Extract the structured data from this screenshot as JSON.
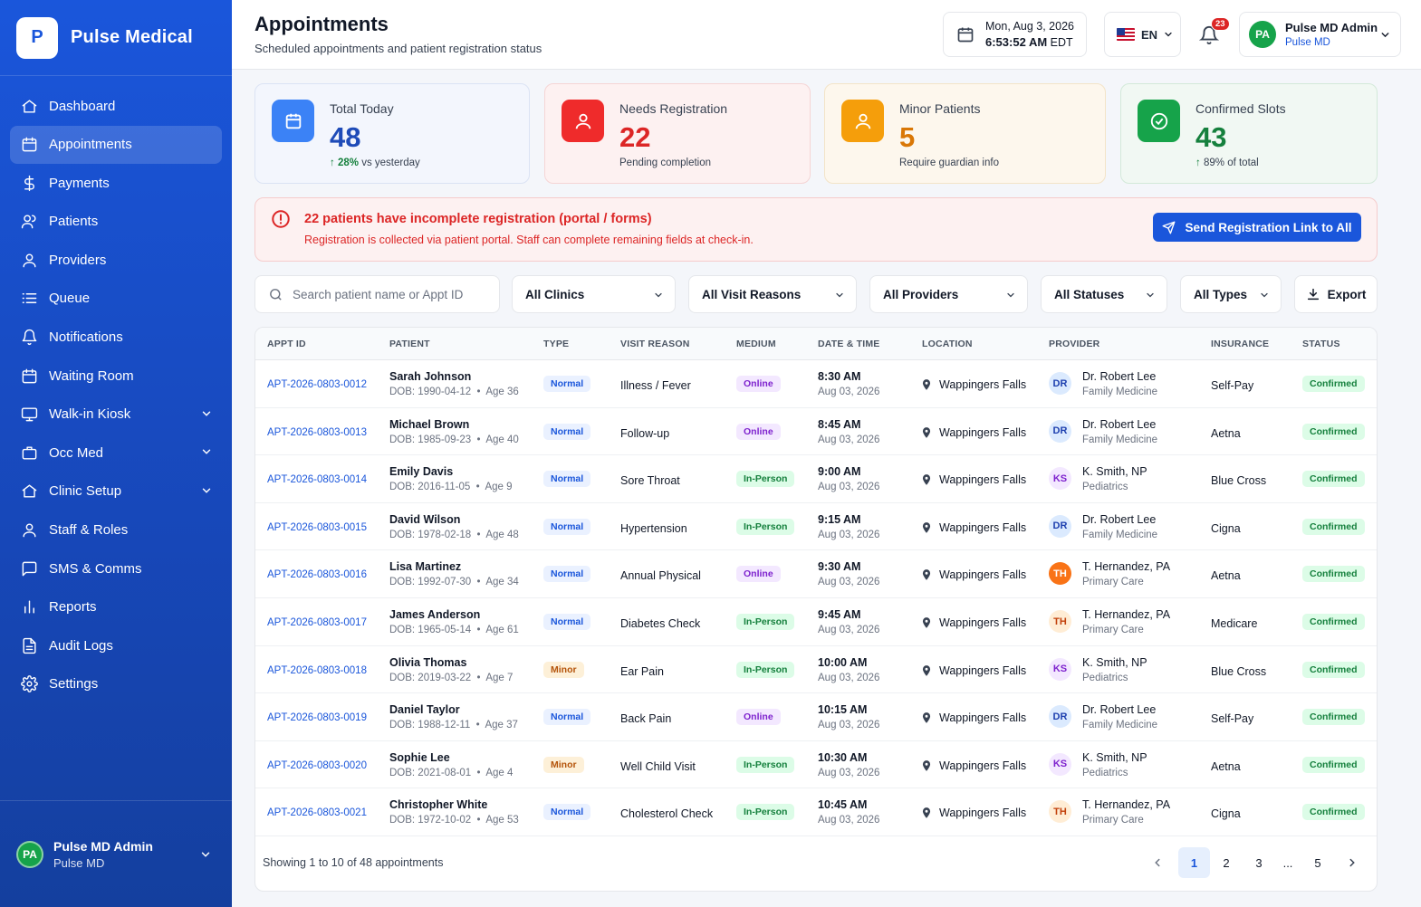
{
  "brand": {
    "logo_letter": "P",
    "name": "Pulse Medical"
  },
  "sidebar": {
    "items": [
      {
        "label": "Dashboard",
        "icon": "home-icon"
      },
      {
        "label": "Appointments",
        "icon": "calendar-icon",
        "active": true
      },
      {
        "label": "Payments",
        "icon": "dollar-icon"
      },
      {
        "label": "Patients",
        "icon": "users-icon"
      },
      {
        "label": "Providers",
        "icon": "user-icon"
      },
      {
        "label": "Queue",
        "icon": "list-icon"
      },
      {
        "label": "Notifications",
        "icon": "bell-icon"
      },
      {
        "label": "Waiting Room",
        "icon": "calendar-icon"
      },
      {
        "label": "Walk-in Kiosk",
        "icon": "monitor-icon",
        "expandable": true
      },
      {
        "label": "Occ Med",
        "icon": "briefcase-icon",
        "expandable": true
      },
      {
        "label": "Clinic Setup",
        "icon": "home-icon",
        "expandable": true
      },
      {
        "label": "Staff & Roles",
        "icon": "user-icon"
      },
      {
        "label": "SMS & Comms",
        "icon": "chat-icon"
      },
      {
        "label": "Reports",
        "icon": "bar-chart-icon"
      },
      {
        "label": "Audit Logs",
        "icon": "file-icon"
      },
      {
        "label": "Settings",
        "icon": "gear-icon"
      }
    ],
    "user": {
      "initials": "PA",
      "name": "Pulse MD Admin",
      "org": "Pulse MD"
    }
  },
  "header": {
    "title": "Appointments",
    "subtitle": "Scheduled appointments and patient registration status",
    "date": "Mon, Aug 3, 2026",
    "time": "6:53:52 AM",
    "tz": "EDT",
    "lang": "EN",
    "notif_count": "23",
    "user": {
      "initials": "PA",
      "name": "Pulse MD Admin",
      "org": "Pulse MD"
    }
  },
  "stats": [
    {
      "label": "Total Today",
      "value": "48",
      "sub_strong": "28%",
      "sub": "vs yesterday"
    },
    {
      "label": "Needs Registration",
      "value": "22",
      "sub": "Pending completion"
    },
    {
      "label": "Minor Patients",
      "value": "5",
      "sub": "Require guardian info"
    },
    {
      "label": "Confirmed Slots",
      "value": "43",
      "sub_strong": "89%",
      "sub": "of total"
    }
  ],
  "alert": {
    "title": "22 patients have incomplete registration (portal / forms)",
    "subtitle": "Registration is collected via patient portal. Staff can complete remaining fields at check-in.",
    "button": "Send Registration Link to All"
  },
  "filters": {
    "search_placeholder": "Search patient name or Appt ID",
    "clinics": "All Clinics",
    "reasons": "All Visit Reasons",
    "providers": "All Providers",
    "statuses": "All Statuses",
    "types": "All Types",
    "export": "Export"
  },
  "table": {
    "columns": [
      "APPT ID",
      "PATIENT",
      "TYPE",
      "VISIT REASON",
      "MEDIUM",
      "DATE & TIME",
      "LOCATION",
      "PROVIDER",
      "INSURANCE",
      "STATUS"
    ],
    "rows": [
      {
        "id": "APT-2026-0803-0012",
        "name": "Sarah Johnson",
        "dob": "DOB: 1990-04-12",
        "age": "Age 36",
        "type": "Normal",
        "reason": "Illness / Fever",
        "medium": "Online",
        "time": "8:30 AM",
        "date": "Aug 03, 2026",
        "location": "Wappingers Falls",
        "prov_initials": "DR",
        "provider": "Dr. Robert Lee",
        "specialty": "Family Medicine",
        "insurance": "Self-Pay",
        "status": "Confirmed"
      },
      {
        "id": "APT-2026-0803-0013",
        "name": "Michael Brown",
        "dob": "DOB: 1985-09-23",
        "age": "Age 40",
        "type": "Normal",
        "reason": "Follow-up",
        "medium": "Online",
        "time": "8:45 AM",
        "date": "Aug 03, 2026",
        "location": "Wappingers Falls",
        "prov_initials": "DR",
        "provider": "Dr. Robert Lee",
        "specialty": "Family Medicine",
        "insurance": "Aetna",
        "status": "Confirmed"
      },
      {
        "id": "APT-2026-0803-0014",
        "name": "Emily Davis",
        "dob": "DOB: 2016-11-05",
        "age": "Age 9",
        "type": "Normal",
        "reason": "Sore Throat",
        "medium": "In-Person",
        "time": "9:00 AM",
        "date": "Aug 03, 2026",
        "location": "Wappingers Falls",
        "prov_initials": "KS",
        "provider": "K. Smith, NP",
        "specialty": "Pediatrics",
        "insurance": "Blue Cross",
        "status": "Confirmed"
      },
      {
        "id": "APT-2026-0803-0015",
        "name": "David Wilson",
        "dob": "DOB: 1978-02-18",
        "age": "Age 48",
        "type": "Normal",
        "reason": "Hypertension",
        "medium": "In-Person",
        "time": "9:15 AM",
        "date": "Aug 03, 2026",
        "location": "Wappingers Falls",
        "prov_initials": "DR",
        "provider": "Dr. Robert Lee",
        "specialty": "Family Medicine",
        "insurance": "Cigna",
        "status": "Confirmed"
      },
      {
        "id": "APT-2026-0803-0016",
        "name": "Lisa Martinez",
        "dob": "DOB: 1992-07-30",
        "age": "Age 34",
        "type": "Normal",
        "reason": "Annual Physical",
        "medium": "Online",
        "time": "9:30 AM",
        "date": "Aug 03, 2026",
        "location": "Wappingers Falls",
        "prov_initials": "TH",
        "provider": "T. Hernandez, PA",
        "specialty": "Primary Care",
        "insurance": "Aetna",
        "status": "Confirmed"
      },
      {
        "id": "APT-2026-0803-0017",
        "name": "James Anderson",
        "dob": "DOB: 1965-05-14",
        "age": "Age 61",
        "type": "Normal",
        "reason": "Diabetes Check",
        "medium": "In-Person",
        "time": "9:45 AM",
        "date": "Aug 03, 2026",
        "location": "Wappingers Falls",
        "prov_initials": "TH",
        "provider": "T. Hernandez, PA",
        "specialty": "Primary Care",
        "insurance": "Medicare",
        "status": "Confirmed"
      },
      {
        "id": "APT-2026-0803-0018",
        "name": "Olivia Thomas",
        "dob": "DOB: 2019-03-22",
        "age": "Age 7",
        "type": "Minor",
        "reason": "Ear Pain",
        "medium": "In-Person",
        "time": "10:00 AM",
        "date": "Aug 03, 2026",
        "location": "Wappingers Falls",
        "prov_initials": "KS",
        "provider": "K. Smith, NP",
        "specialty": "Pediatrics",
        "insurance": "Blue Cross",
        "status": "Confirmed"
      },
      {
        "id": "APT-2026-0803-0019",
        "name": "Daniel Taylor",
        "dob": "DOB: 1988-12-11",
        "age": "Age 37",
        "type": "Normal",
        "reason": "Back Pain",
        "medium": "Online",
        "time": "10:15 AM",
        "date": "Aug 03, 2026",
        "location": "Wappingers Falls",
        "prov_initials": "DR",
        "provider": "Dr. Robert Lee",
        "specialty": "Family Medicine",
        "insurance": "Self-Pay",
        "status": "Confirmed"
      },
      {
        "id": "APT-2026-0803-0020",
        "name": "Sophie Lee",
        "dob": "DOB: 2021-08-01",
        "age": "Age 4",
        "type": "Minor",
        "reason": "Well Child Visit",
        "medium": "In-Person",
        "time": "10:30 AM",
        "date": "Aug 03, 2026",
        "location": "Wappingers Falls",
        "prov_initials": "KS",
        "provider": "K. Smith, NP",
        "specialty": "Pediatrics",
        "insurance": "Aetna",
        "status": "Confirmed"
      },
      {
        "id": "APT-2026-0803-0021",
        "name": "Christopher White",
        "dob": "DOB: 1972-10-02",
        "age": "Age 53",
        "type": "Normal",
        "reason": "Cholesterol Check",
        "medium": "In-Person",
        "time": "10:45 AM",
        "date": "Aug 03, 2026",
        "location": "Wappingers Falls",
        "prov_initials": "TH",
        "provider": "T. Hernandez, PA",
        "specialty": "Primary Care",
        "insurance": "Cigna",
        "status": "Confirmed"
      }
    ]
  },
  "pagination": {
    "summary": "Showing 1 to 10 of 48 appointments",
    "pages": [
      "1",
      "2",
      "3",
      "...",
      "5"
    ],
    "current": "1"
  },
  "colors": {
    "primary": "#1a56db",
    "danger": "#dc2626",
    "warning": "#f59e0b",
    "success": "#16a34a"
  }
}
